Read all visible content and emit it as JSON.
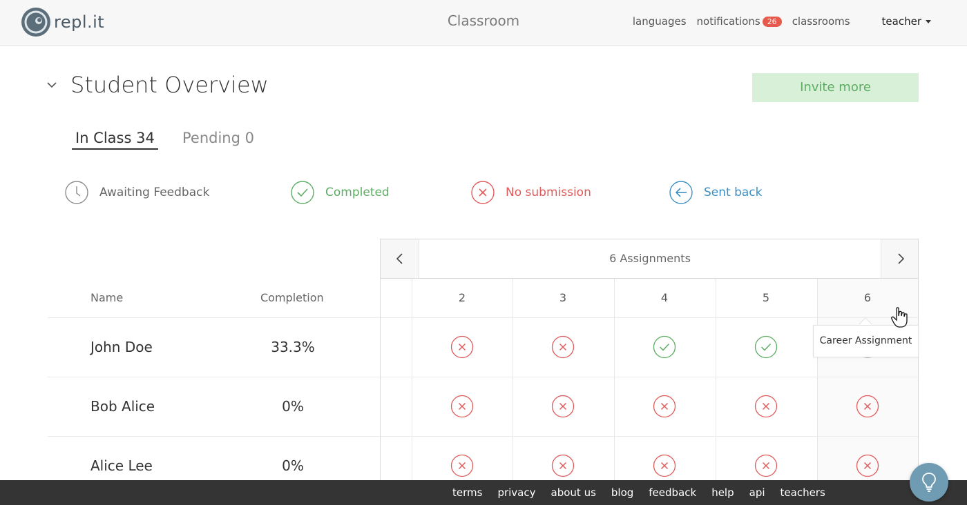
{
  "header": {
    "logo_text": "repl.it",
    "page_title": "Classroom",
    "nav": {
      "languages": "languages",
      "notifications": "notifications",
      "notification_count": "26",
      "classrooms": "classrooms",
      "user": "teacher"
    }
  },
  "overview": {
    "title": "Student Overview",
    "invite_label": "Invite more",
    "tabs": [
      {
        "label": "In Class 34"
      },
      {
        "label": "Pending 0"
      }
    ],
    "legend": [
      {
        "label": "Awaiting Feedback",
        "icon": "clock-icon",
        "color": "#777777"
      },
      {
        "label": "Completed",
        "icon": "check-icon",
        "color": "#5cad62"
      },
      {
        "label": "No submission",
        "icon": "x-icon",
        "color": "#e05a5a"
      },
      {
        "label": "Sent back",
        "icon": "arrow-left-icon",
        "color": "#3a8fc4"
      }
    ]
  },
  "table": {
    "name_header": "Name",
    "completion_header": "Completion",
    "assignments_title": "6 Assignments",
    "assignment_columns": [
      "2",
      "3",
      "4",
      "5",
      "6"
    ],
    "tooltip": "Career Assignment",
    "rows": [
      {
        "name": "John Doe",
        "completion": "33.3%",
        "status": [
          "none",
          "none",
          "done",
          "done",
          "hidden"
        ]
      },
      {
        "name": "Bob Alice",
        "completion": "0%",
        "status": [
          "none",
          "none",
          "none",
          "none",
          "none"
        ]
      },
      {
        "name": "Alice Lee",
        "completion": "0%",
        "status": [
          "none",
          "none",
          "none",
          "none",
          "none"
        ]
      }
    ]
  },
  "footer": {
    "links": [
      "terms",
      "privacy",
      "about us",
      "blog",
      "feedback",
      "help",
      "api",
      "teachers"
    ]
  }
}
